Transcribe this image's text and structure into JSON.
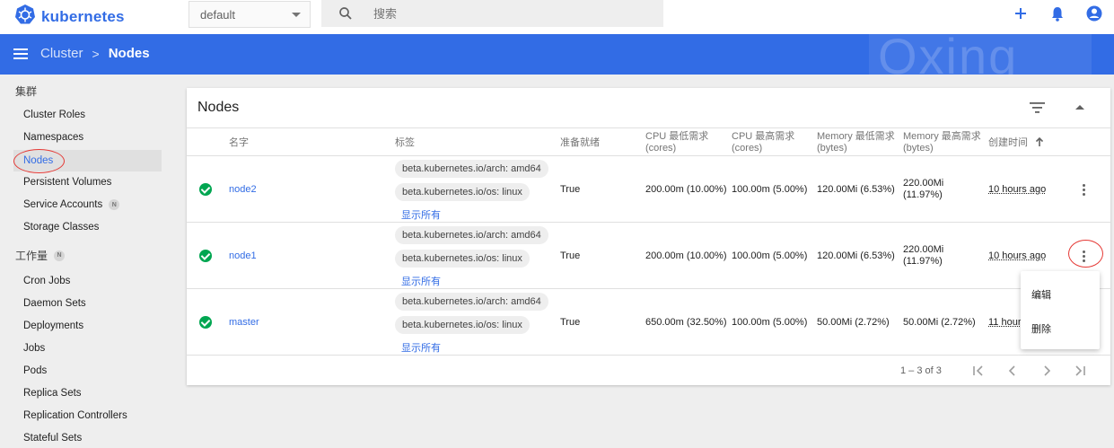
{
  "topbar": {
    "brand": "kubernetes",
    "namespace_value": "default",
    "search_placeholder": "搜索"
  },
  "breadcrumb": {
    "parent": "Cluster",
    "separator": ">",
    "current": "Nodes"
  },
  "watermark": "Oxing",
  "sidebar": {
    "cluster_heading": "集群",
    "cluster_items": [
      "Cluster Roles",
      "Namespaces",
      "Nodes",
      "Persistent Volumes",
      "Service Accounts",
      "Storage Classes"
    ],
    "service_accounts_badge": "N",
    "workloads_heading": "工作量",
    "workloads_badge": "N",
    "workload_items": [
      "Cron Jobs",
      "Daemon Sets",
      "Deployments",
      "Jobs",
      "Pods",
      "Replica Sets",
      "Replication Controllers",
      "Stateful Sets"
    ]
  },
  "card": {
    "title": "Nodes",
    "headers": {
      "name": "名字",
      "labels": "标签",
      "ready": "准备就绪",
      "cpu_req_1": "CPU 最低需求",
      "cpu_req_2": "(cores)",
      "cpu_lim_1": "CPU 最高需求",
      "cpu_lim_2": "(cores)",
      "mem_req_1": "Memory 最低需求",
      "mem_req_2": "(bytes)",
      "mem_lim_1": "Memory 最高需求",
      "mem_lim_2": "(bytes)",
      "created": "创建时间"
    },
    "rows": [
      {
        "name": "node2",
        "label1": "beta.kubernetes.io/arch: amd64",
        "label2": "beta.kubernetes.io/os: linux",
        "show_all": "显示所有",
        "ready": "True",
        "cpu_req": "200.00m (10.00%)",
        "cpu_lim": "100.00m (5.00%)",
        "mem_req": "120.00Mi (6.53%)",
        "mem_lim_1": "220.00Mi",
        "mem_lim_2": "(11.97%)",
        "created": "10 hours ago"
      },
      {
        "name": "node1",
        "label1": "beta.kubernetes.io/arch: amd64",
        "label2": "beta.kubernetes.io/os: linux",
        "show_all": "显示所有",
        "ready": "True",
        "cpu_req": "200.00m (10.00%)",
        "cpu_lim": "100.00m (5.00%)",
        "mem_req": "120.00Mi (6.53%)",
        "mem_lim_1": "220.00Mi",
        "mem_lim_2": "(11.97%)",
        "created": "10 hours ago"
      },
      {
        "name": "master",
        "label1": "beta.kubernetes.io/arch: amd64",
        "label2": "beta.kubernetes.io/os: linux",
        "show_all": "显示所有",
        "ready": "True",
        "cpu_req": "650.00m (32.50%)",
        "cpu_lim": "100.00m (5.00%)",
        "mem_req": "50.00Mi (2.72%)",
        "mem_lim_1": "50.00Mi (2.72%)",
        "mem_lim_2": "",
        "created": "11 hours"
      }
    ],
    "pager": "1 – 3 of 3"
  },
  "context_menu": {
    "edit": "编辑",
    "delete": "删除"
  },
  "colors": {
    "brand": "#326ce5",
    "ready": "#00a651",
    "highlight": "#e53935"
  }
}
